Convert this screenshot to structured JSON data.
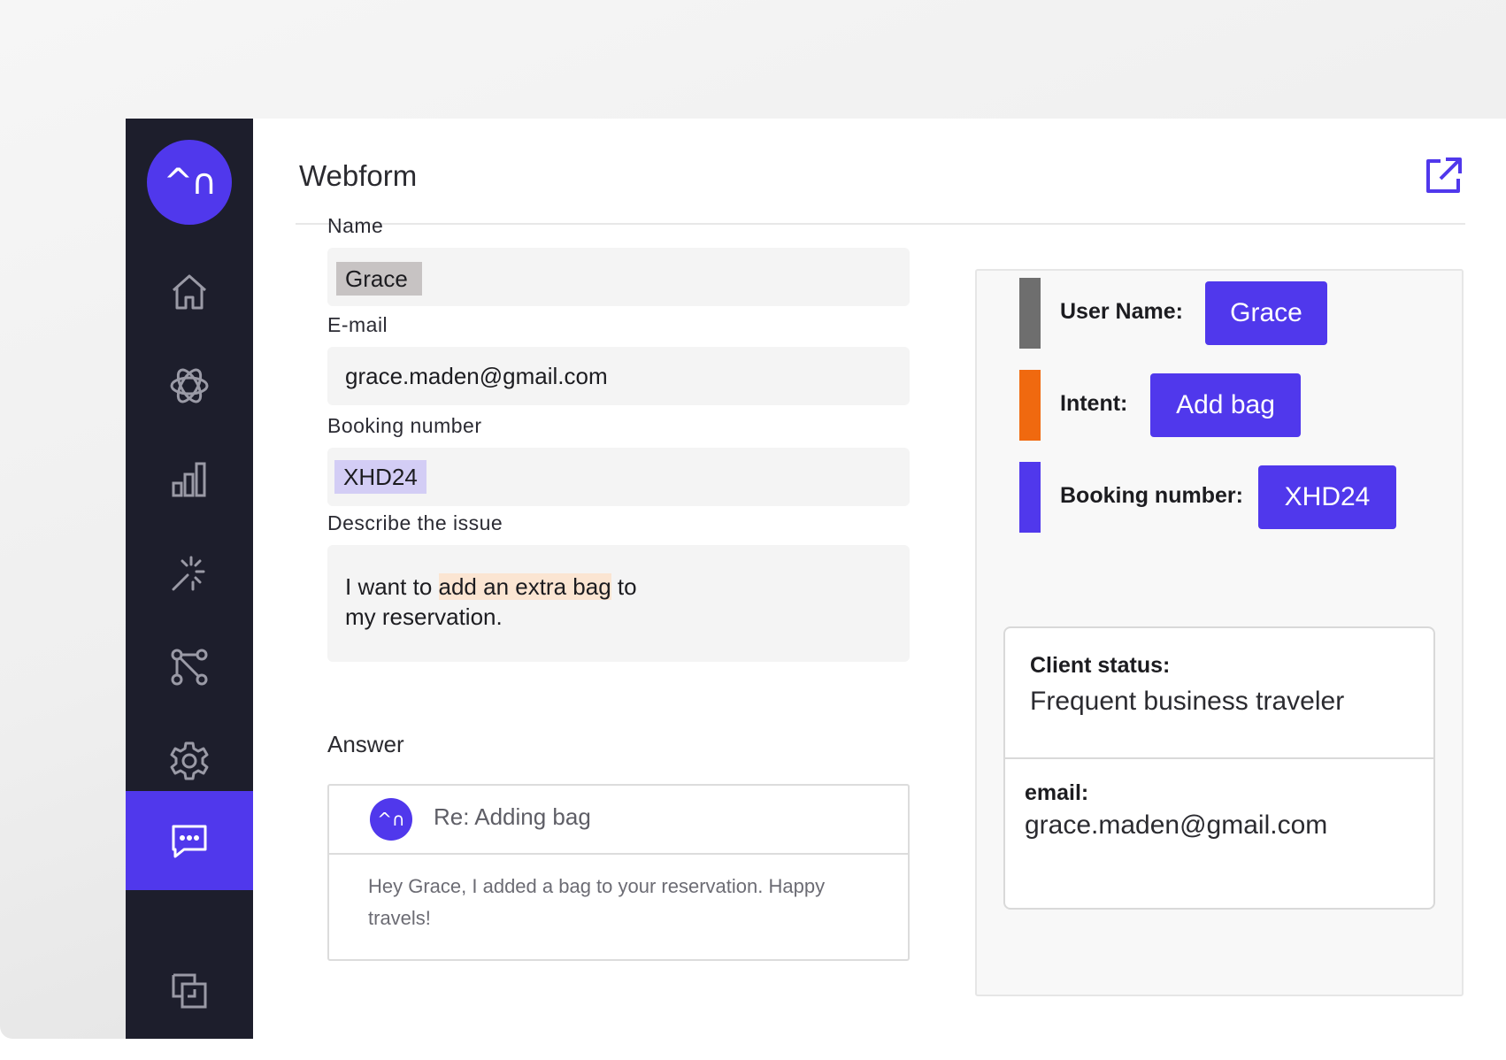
{
  "app": {
    "logo_glyph": "^∩",
    "title": "Webform"
  },
  "sidebar": {
    "items": [
      {
        "icon": "home-icon"
      },
      {
        "icon": "atom-icon"
      },
      {
        "icon": "bar-chart-icon"
      },
      {
        "icon": "sparkle-icon"
      },
      {
        "icon": "flow-icon"
      },
      {
        "icon": "gear-icon"
      },
      {
        "icon": "chat-icon",
        "active": true
      },
      {
        "icon": "copy-icon"
      }
    ]
  },
  "form": {
    "name": {
      "label": "Name",
      "value": "Grace"
    },
    "email": {
      "label": "E-mail",
      "value": "grace.maden@gmail.com"
    },
    "booking": {
      "label": "Booking number",
      "value": "XHD24"
    },
    "issue": {
      "label": "Describe the issue",
      "text_before": "I want to ",
      "highlight": "add an extra bag",
      "text_after_line1": " to",
      "line2": "my reservation."
    }
  },
  "answer": {
    "label": "Answer",
    "avatar_glyph": "^∩",
    "subject": "Re: Adding bag",
    "body": "Hey Grace, I added a bag to your reservation. Happy travels!"
  },
  "entities": [
    {
      "label": "User Name:",
      "value": "Grace",
      "color": "#6e6e6e"
    },
    {
      "label": "Intent:",
      "value": "Add bag",
      "color": "#f0690f"
    },
    {
      "label": "Booking number:",
      "value": "XHD24",
      "color": "#5038ec"
    }
  ],
  "client": {
    "status_label": "Client status:",
    "status_value": "Frequent business traveler",
    "email_label": "email:",
    "email_value": "grace.maden@gmail.com"
  },
  "colors": {
    "accent": "#5038ec",
    "sidebar": "#1d1e2c"
  }
}
